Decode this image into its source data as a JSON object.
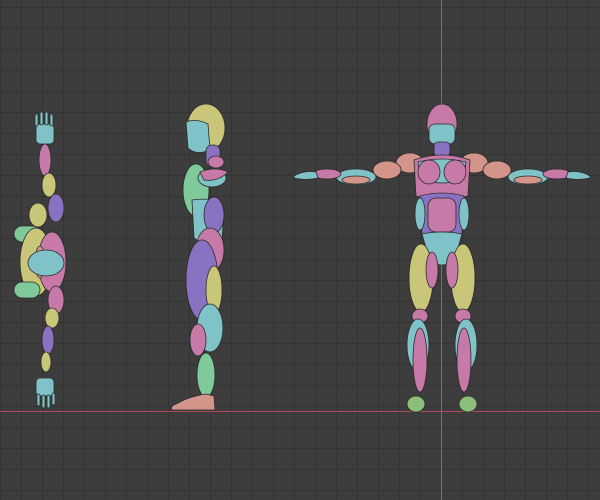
{
  "viewport": {
    "background": "#3d3d3d",
    "grid_color": "#333333",
    "x_axis_color": "#b34a5a",
    "y_axis_color": "#4f78b8"
  },
  "palette": {
    "pink": "#c77aa8",
    "teal": "#7fc2c7",
    "yellow": "#c9c67a",
    "purple": "#8a72c2",
    "salmon": "#d3958a",
    "green": "#7fc99b",
    "mint": "#8fd4a6"
  },
  "views": [
    "top",
    "side",
    "front"
  ]
}
